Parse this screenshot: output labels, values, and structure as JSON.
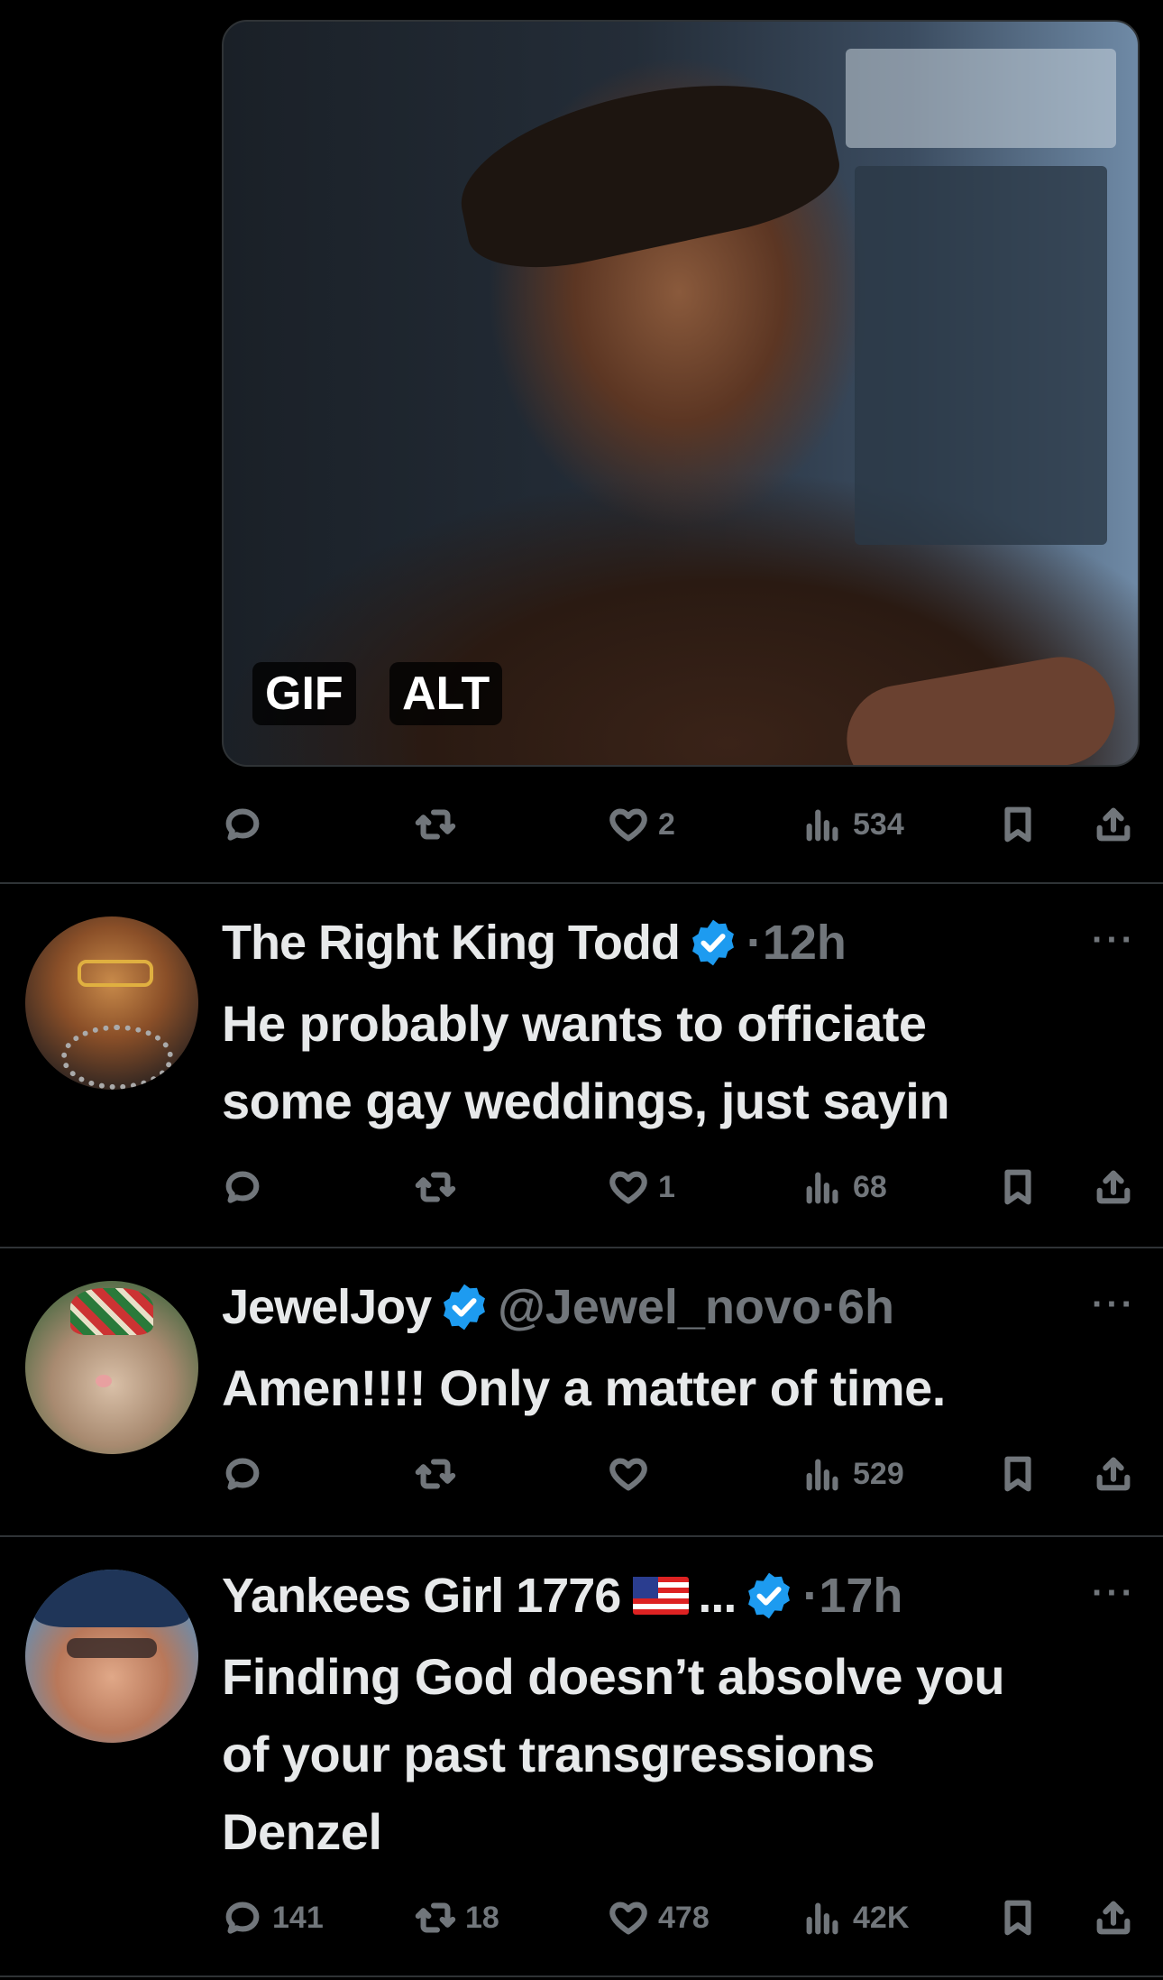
{
  "media": {
    "gif_label": "GIF",
    "alt_label": "ALT"
  },
  "tweets": [
    {
      "actions": {
        "replies": "",
        "retweets": "",
        "likes": "2",
        "views": "534"
      }
    },
    {
      "name": "The Right King Todd",
      "verified": true,
      "handle": "",
      "separator": "·",
      "time": "12h",
      "text_lines": [
        "He probably wants to officiate",
        "some gay weddings, just sayin"
      ],
      "actions": {
        "replies": "",
        "retweets": "",
        "likes": "1",
        "views": "68"
      }
    },
    {
      "name": "JewelJoy",
      "verified": true,
      "handle": "@Jewel_novo",
      "separator": "·",
      "time": "6h",
      "text_lines": [
        "Amen!!!! Only a matter of time."
      ],
      "actions": {
        "replies": "",
        "retweets": "",
        "likes": "",
        "views": "529"
      }
    },
    {
      "name": "Yankees Girl 1776",
      "name_suffix": "...",
      "verified": true,
      "separator": "·",
      "time": "17h",
      "text_lines": [
        "Finding God doesn’t absolve you",
        "of your past transgressions",
        "Denzel"
      ],
      "actions": {
        "replies": "141",
        "retweets": "18",
        "likes": "478",
        "views": "42K"
      }
    }
  ],
  "more_label": "···",
  "colors": {
    "background": "#000000",
    "text": "#e7e9ea",
    "muted": "#71767b",
    "verified": "#1d9bf0",
    "divider": "#2f3336"
  },
  "icons": [
    "reply-icon",
    "retweet-icon",
    "like-icon",
    "views-icon",
    "bookmark-icon",
    "share-icon",
    "verified-badge-icon",
    "more-icon"
  ]
}
